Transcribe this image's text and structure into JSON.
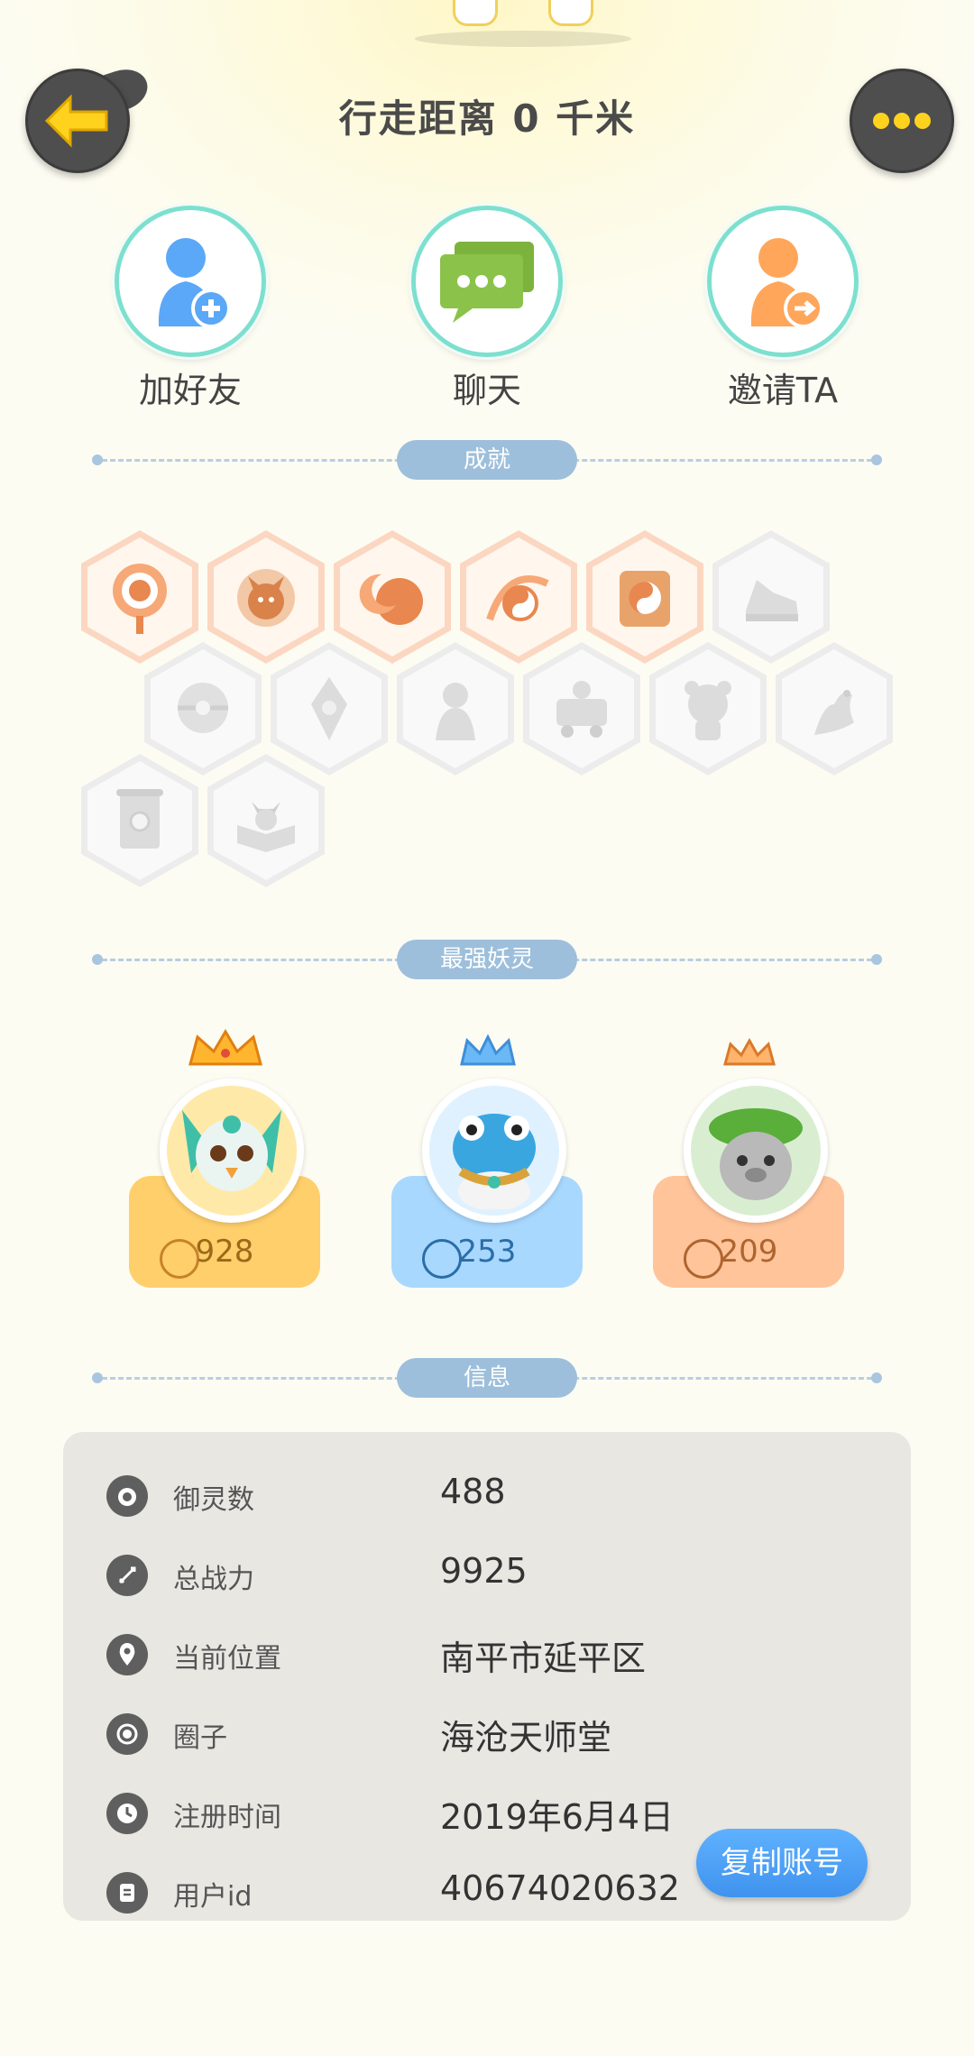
{
  "header": {
    "title": "行走距离 0 千米",
    "back_icon": "arrow-left-icon",
    "more_icon": "ellipsis-icon"
  },
  "actions": [
    {
      "label": "加好友",
      "icon": "add-friend-icon"
    },
    {
      "label": "聊天",
      "icon": "chat-icon"
    },
    {
      "label": "邀请TA",
      "icon": "invite-icon"
    }
  ],
  "sections": {
    "achievements": "成就",
    "strongest": "最强妖灵",
    "info": "信息"
  },
  "achievements": [
    {
      "icon": "target-badge-icon",
      "unlocked": true
    },
    {
      "icon": "fox-badge-icon",
      "unlocked": true
    },
    {
      "icon": "moon-badge-icon",
      "unlocked": true
    },
    {
      "icon": "yinyang-swirl-badge-icon",
      "unlocked": true
    },
    {
      "icon": "taiji-book-badge-icon",
      "unlocked": true
    },
    {
      "icon": "sneaker-badge-icon",
      "unlocked": false
    },
    {
      "icon": "ball-badge-icon",
      "unlocked": false
    },
    {
      "icon": "crystal-badge-icon",
      "unlocked": false
    },
    {
      "icon": "spirit-badge-icon",
      "unlocked": false
    },
    {
      "icon": "cart-badge-icon",
      "unlocked": false
    },
    {
      "icon": "bear-badge-icon",
      "unlocked": false
    },
    {
      "icon": "dragon-badge-icon",
      "unlocked": false
    },
    {
      "icon": "scroll-badge-icon",
      "unlocked": false
    },
    {
      "icon": "open-book-badge-icon",
      "unlocked": false
    }
  ],
  "pets": [
    {
      "power": "928",
      "crown": "gold",
      "color": "#ffcf6b",
      "text_color": "#9a6a18"
    },
    {
      "power": "253",
      "crown": "blue",
      "color": "#a9d8ff",
      "text_color": "#2a6ea8"
    },
    {
      "power": "209",
      "crown": "bronze",
      "color": "#ffc49a",
      "text_color": "#b0642e"
    }
  ],
  "info": {
    "rows": [
      {
        "key": "御灵数",
        "value": "488",
        "icon": "spirit-count-icon"
      },
      {
        "key": "总战力",
        "value": "9925",
        "icon": "sword-icon"
      },
      {
        "key": "当前位置",
        "value": "南平市延平区",
        "icon": "location-pin-icon"
      },
      {
        "key": "圈子",
        "value": "海沧天师堂",
        "icon": "circle-target-icon"
      },
      {
        "key": "注册时间",
        "value": "2019年6月4日",
        "icon": "clock-icon"
      },
      {
        "key": "用户id",
        "value": "40674020632",
        "icon": "id-card-icon"
      }
    ],
    "copy_button": "复制账号"
  }
}
